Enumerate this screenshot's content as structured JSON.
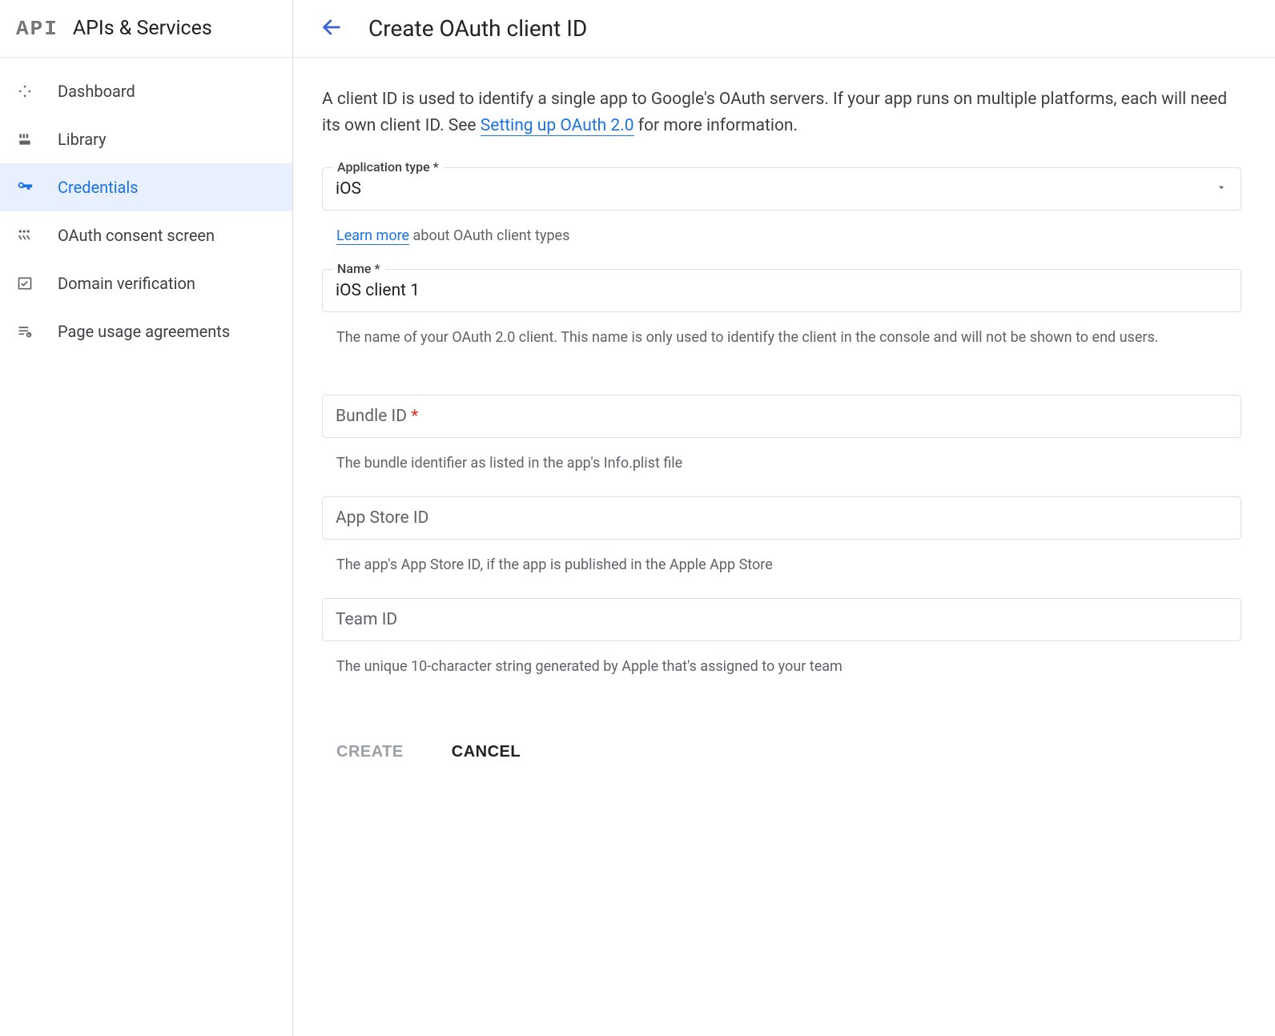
{
  "sidebar": {
    "logo": "API",
    "title": "APIs & Services",
    "items": [
      {
        "label": "Dashboard",
        "icon": "dashboard"
      },
      {
        "label": "Library",
        "icon": "library"
      },
      {
        "label": "Credentials",
        "icon": "key",
        "active": true
      },
      {
        "label": "OAuth consent screen",
        "icon": "consent"
      },
      {
        "label": "Domain verification",
        "icon": "domain"
      },
      {
        "label": "Page usage agreements",
        "icon": "agreements"
      }
    ]
  },
  "header": {
    "title": "Create OAuth client ID"
  },
  "intro": {
    "text_before": "A client ID is used to identify a single app to Google's OAuth servers. If your app runs on multiple platforms, each will need its own client ID. See ",
    "link": "Setting up OAuth 2.0",
    "text_after": " for more information."
  },
  "form": {
    "application_type": {
      "label": "Application type *",
      "value": "iOS",
      "help_link": "Learn more",
      "help_text": " about OAuth client types"
    },
    "name": {
      "label": "Name *",
      "value": "iOS client 1",
      "help": "The name of your OAuth 2.0 client. This name is only used to identify the client in the console and will not be shown to end users."
    },
    "bundle_id": {
      "placeholder": "Bundle ID ",
      "required_mark": "*",
      "help": "The bundle identifier as listed in the app's Info.plist file"
    },
    "app_store_id": {
      "placeholder": "App Store ID",
      "help": "The app's App Store ID, if the app is published in the Apple App Store"
    },
    "team_id": {
      "placeholder": "Team ID",
      "help": "The unique 10-character string generated by Apple that's assigned to your team"
    }
  },
  "actions": {
    "create": "CREATE",
    "cancel": "CANCEL"
  }
}
